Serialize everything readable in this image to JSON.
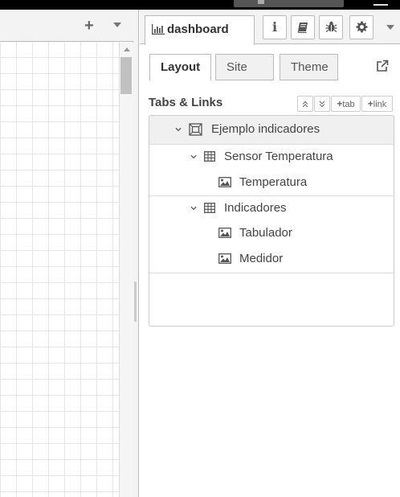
{
  "sidebar": {
    "tab_label": "dashboard",
    "subtabs": [
      "Layout",
      "Site",
      "Theme"
    ],
    "section_title": "Tabs & Links",
    "mini_buttons": {
      "collapse_all": "«",
      "expand_all": "»",
      "add_tab": "tab",
      "add_link": "link"
    },
    "info_button": "i"
  },
  "tree": {
    "tab": {
      "label": "Ejemplo indicadores",
      "icon": "tab-icon"
    },
    "groups": [
      {
        "label": "Sensor Temperatura",
        "icon": "table-icon",
        "widgets": [
          "Temperatura"
        ]
      },
      {
        "label": "Indicadores",
        "icon": "table-icon",
        "widgets": [
          "Tabulador",
          "Medidor"
        ]
      }
    ]
  },
  "workspace": {
    "add_label": "+"
  }
}
